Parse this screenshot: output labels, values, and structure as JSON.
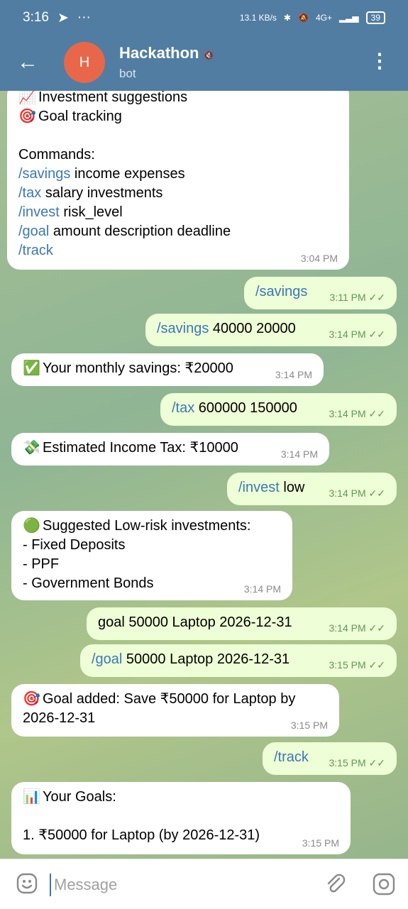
{
  "status_bar": {
    "time": "3:16",
    "net_speed": "13.1 KB/s",
    "network": "4G+",
    "battery": "39"
  },
  "header": {
    "avatar_letter": "H",
    "title": "Hackathon",
    "subtitle": "bot"
  },
  "messages": [
    {
      "dir": "in",
      "lines": [
        {
          "emoji": "📈",
          "text": "Investment suggestions"
        },
        {
          "emoji": "🎯",
          "text": "Goal tracking"
        },
        {
          "text": ""
        },
        {
          "text": "Commands:"
        },
        {
          "cmd": "/savings",
          "text": " income expenses"
        },
        {
          "cmd": "/tax",
          "text": " salary investments"
        },
        {
          "cmd": "/invest",
          "text": " risk_level"
        },
        {
          "cmd": "/goal",
          "text": " amount description deadline"
        },
        {
          "cmd": "/track",
          "text": ""
        }
      ],
      "time": "3:04 PM"
    },
    {
      "dir": "out",
      "lines": [
        {
          "cmd": "/savings",
          "text": ""
        }
      ],
      "time": "3:11 PM"
    },
    {
      "dir": "out",
      "lines": [
        {
          "cmd": "/savings",
          "text": " 40000 20000"
        }
      ],
      "time": "3:14 PM"
    },
    {
      "dir": "in",
      "lines": [
        {
          "emoji": "✅",
          "text": "Your monthly savings: ₹20000"
        }
      ],
      "time": "3:14 PM"
    },
    {
      "dir": "out",
      "lines": [
        {
          "cmd": "/tax",
          "text": " 600000 150000"
        }
      ],
      "time": "3:14 PM"
    },
    {
      "dir": "in",
      "lines": [
        {
          "emoji": "💸",
          "text": "Estimated Income Tax: ₹10000"
        }
      ],
      "time": "3:14 PM"
    },
    {
      "dir": "out",
      "lines": [
        {
          "cmd": "/invest",
          "text": " low"
        }
      ],
      "time": "3:14 PM"
    },
    {
      "dir": "in",
      "lines": [
        {
          "emoji": "🟢",
          "text": "Suggested Low-risk investments:"
        },
        {
          "text": "- Fixed Deposits"
        },
        {
          "text": "- PPF"
        },
        {
          "text": "- Government Bonds"
        }
      ],
      "time": "3:14 PM"
    },
    {
      "dir": "out",
      "lines": [
        {
          "text": "goal 50000 Laptop 2026-12-31"
        }
      ],
      "time": "3:14 PM"
    },
    {
      "dir": "out",
      "lines": [
        {
          "cmd": "/goal",
          "text": " 50000 Laptop 2026-12-31"
        }
      ],
      "time": "3:15 PM"
    },
    {
      "dir": "in",
      "lines": [
        {
          "emoji": "🎯",
          "text": "Goal added: Save ₹50000 for Laptop by"
        },
        {
          "text": "2026-12-31"
        }
      ],
      "time": "3:15 PM"
    },
    {
      "dir": "out",
      "lines": [
        {
          "cmd": "/track",
          "text": ""
        }
      ],
      "time": "3:15 PM"
    },
    {
      "dir": "in",
      "lines": [
        {
          "emoji": "📊",
          "text": "Your Goals:"
        },
        {
          "text": ""
        },
        {
          "text": "1. ₹50000 for Laptop (by 2026-12-31)"
        }
      ],
      "time": "3:15 PM"
    }
  ],
  "input": {
    "placeholder": "Message"
  },
  "colors": {
    "header": "#517da2",
    "outgoing_bubble": "#eefed6",
    "incoming_bubble": "#ffffff",
    "command_link": "#3b78b5",
    "avatar": "#e8674a"
  }
}
